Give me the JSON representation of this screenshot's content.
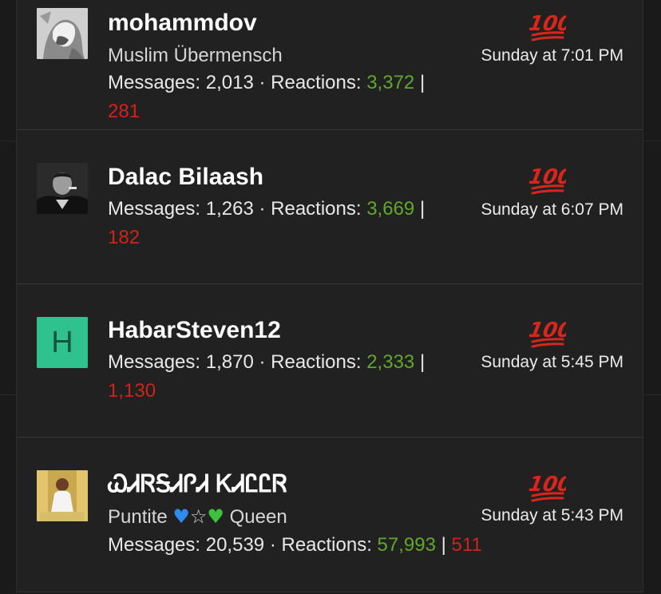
{
  "colors": {
    "positive": "#5fa82a",
    "negative": "#d0241b",
    "avatar_letter_bg": "#2fc18e"
  },
  "rows": [
    {
      "name": "mohammdov",
      "title": "Muslim Übermensch",
      "messages_label": "Messages:",
      "messages": "2,013",
      "separator": "·",
      "reactions_label": "Reactions:",
      "reactions_positive": "3,372",
      "divider": "|",
      "reactions_negative": "281",
      "time": "Sunday at 7:01 PM",
      "reaction_icon": "hundred-points-icon",
      "avatar": "statue-avatar"
    },
    {
      "name": "Dalac Bilaash",
      "messages_label": "Messages:",
      "messages": "1,263",
      "separator": "·",
      "reactions_label": "Reactions:",
      "reactions_positive": "3,669",
      "divider": "|",
      "reactions_negative": "182",
      "time": "Sunday at 6:07 PM",
      "reaction_icon": "hundred-points-icon",
      "avatar": "soldier-avatar"
    },
    {
      "name": "HabarSteven12",
      "avatar_letter": "H",
      "messages_label": "Messages:",
      "messages": "1,870",
      "separator": "·",
      "reactions_label": "Reactions:",
      "reactions_positive": "2,333",
      "divider": "|",
      "reactions_negative": "1,130",
      "time": "Sunday at 5:45 PM",
      "reaction_icon": "hundred-points-icon",
      "avatar": "letter-avatar"
    },
    {
      "name": "ᏇᏗᏒᎦᏗᎵᏗ ᏦᏗᏝᏝᏒ",
      "title_text": "Puntite",
      "title_star": "☆",
      "title_suffix": "Queen",
      "messages_label": "Messages:",
      "messages": "20,539",
      "separator": "·",
      "reactions_label": "Reactions:",
      "reactions_positive": "57,993",
      "divider": "|",
      "reactions_negative": "511",
      "time": "Sunday at 5:43 PM",
      "reaction_icon": "hundred-points-icon",
      "avatar": "queen-avatar"
    }
  ]
}
